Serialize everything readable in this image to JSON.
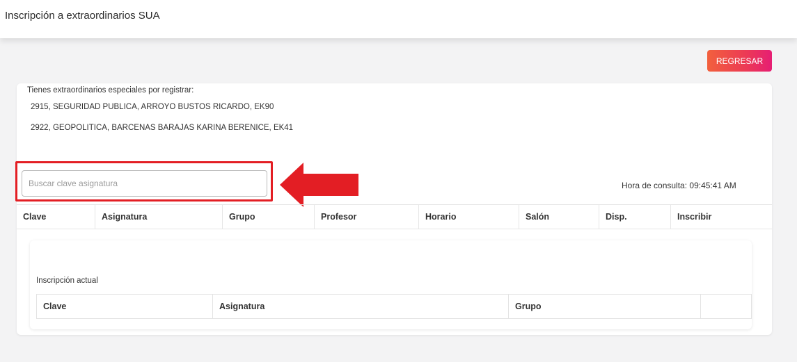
{
  "header": {
    "title": "Inscripción a extraordinarios SUA"
  },
  "actions": {
    "back_label": "REGRESAR"
  },
  "pending": {
    "heading": "Tienes extraordinarios especiales por registrar:",
    "items": [
      "2915, SEGURIDAD PUBLICA, ARROYO BUSTOS RICARDO, EK90",
      "2922, GEOPOLITICA, BARCENAS BARAJAS KARINA BERENICE, EK41"
    ]
  },
  "search": {
    "placeholder": "Buscar clave asignatura",
    "value": ""
  },
  "query_time": "Hora de consulta: 09:45:41 AM",
  "subjects_table": {
    "columns": [
      "Clave",
      "Asignatura",
      "Grupo",
      "Profesor",
      "Horario",
      "Salón",
      "Disp.",
      "Inscribir"
    ]
  },
  "current": {
    "label": "Inscripción actual",
    "columns": [
      "Clave",
      "Asignatura",
      "Grupo",
      ""
    ]
  },
  "colors": {
    "highlight": "#e31e24",
    "button_gradient_start": "#f2603d",
    "button_gradient_end": "#e61e74"
  }
}
